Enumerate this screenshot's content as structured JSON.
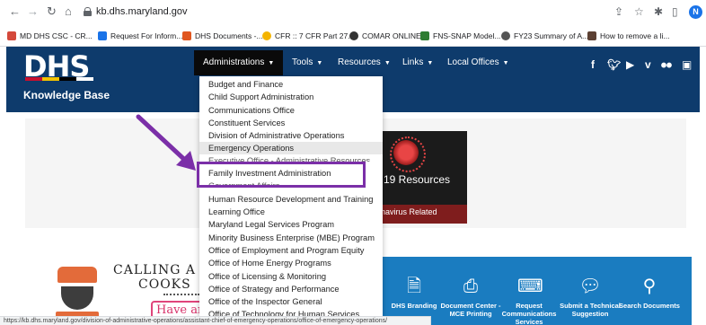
{
  "browser": {
    "url": "kb.dhs.maryland.gov",
    "profile_initial": "N",
    "nav_icons": [
      "back-arrow",
      "forward-arrow",
      "reload",
      "home"
    ],
    "tool_icons": [
      "share",
      "star",
      "extensions",
      "sidebar"
    ],
    "bookmarks": [
      {
        "label": "MD DHS CSC - CR...",
        "icon_color": "#d4493b"
      },
      {
        "label": "Request For Inform...",
        "icon_color": "#1a73e8"
      },
      {
        "label": "DHS Documents -...",
        "icon_color": "#e0561f"
      },
      {
        "label": "CFR :: 7 CFR Part 27...",
        "icon_color": "#f4b400"
      },
      {
        "label": "COMAR ONLINE",
        "icon_color": "#333333"
      },
      {
        "label": "FNS-SNAP Model...",
        "icon_color": "#2e7d32"
      },
      {
        "label": "FY23 Summary of A...",
        "icon_color": "#555555"
      },
      {
        "label": "How to remove a li...",
        "icon_color": "#5c4033"
      }
    ],
    "status_url": "https://kb.dhs.maryland.gov/division-of-administrative-operations/assistant-chief-of-emergency-operations/office-of-emergency-operations/"
  },
  "site": {
    "logo_text": "DHS",
    "subtitle": "Knowledge Base",
    "header_color": "#0e3b6c",
    "nav": [
      {
        "label": "Administrations",
        "active": true
      },
      {
        "label": "Tools"
      },
      {
        "label": "Resources"
      },
      {
        "label": "Links"
      },
      {
        "label": "Local Offices"
      }
    ],
    "social_icons": [
      "facebook-icon",
      "twitter-icon",
      "youtube-icon",
      "vimeo-icon",
      "flickr-icon",
      "camera-icon"
    ]
  },
  "dropdown": {
    "items": [
      "Budget and Finance",
      "Child Support Administration",
      "Communications Office",
      "Constituent Services",
      "Division of Administrative Operations",
      "Emergency Operations",
      "Executive Office - Administrative Resources",
      "Family Investment Administration",
      "Government Affairs",
      "Human Resource Development and Training",
      "Learning Office",
      "Maryland Legal Services Program",
      "Minority Business Enterprise (MBE) Program",
      "Office of Employment and Program Equity",
      "Office of Home Energy Programs",
      "Office of Licensing & Monitoring",
      "Office of Strategy and Performance",
      "Office of the Inspector General",
      "Office of Technology for Human Services"
    ],
    "hovered_index": 5,
    "highlighted_index": 7
  },
  "annotation": {
    "color": "#7b2fa8",
    "target": "Family Investment Administration"
  },
  "covid_tile": {
    "title": "19 Resources",
    "subtitle": "navirus Related"
  },
  "cooks_ad": {
    "line1": "CALLING A",
    "line2": "COOKS",
    "line3": "Have any"
  },
  "tiles": [
    {
      "icon": "document-icon",
      "label": "DHS Branding"
    },
    {
      "icon": "printer-icon",
      "label": "Document Center - MCE Printing"
    },
    {
      "icon": "keyboard-icon",
      "label": "Request Communications Services"
    },
    {
      "icon": "chat-icon",
      "label": "Submit a Technical Suggestion"
    },
    {
      "icon": "magnifier-icon",
      "label": "Search Documents"
    }
  ]
}
